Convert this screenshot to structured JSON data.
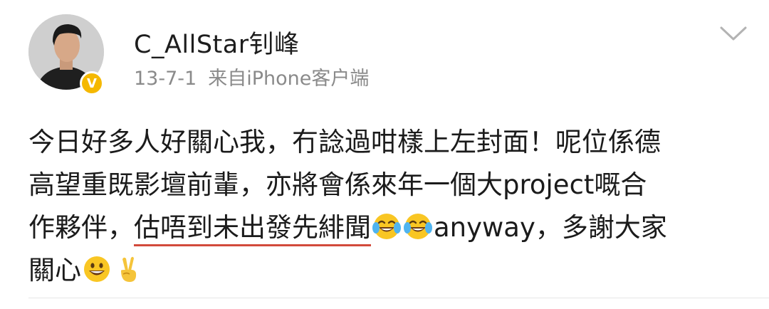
{
  "post": {
    "username": "C_AllStar钊峰",
    "date": "13-7-1",
    "source": "来自iPhone客户端",
    "content": {
      "line1": "今日好多人好關心我，冇諗過咁樣上左封面！呢位係德",
      "line2": "高望重既影壇前輩，亦將會係來年一個大project嘅合",
      "line3_before": "作夥伴，",
      "line3_underlined": "估唔到未出發先緋聞",
      "line3_after": "anyway，多謝大家",
      "line4": "關心"
    }
  },
  "icons": {
    "verified": "verified-badge-icon",
    "menu": "chevron-down-icon",
    "emojis": [
      "tears-of-joy-emoji",
      "tears-of-joy-emoji",
      "grinning-emoji",
      "victory-hand-emoji"
    ]
  },
  "colors": {
    "underline": "#d24a3b",
    "badge": "#f5b800",
    "meta_text": "#8a8a8a"
  }
}
